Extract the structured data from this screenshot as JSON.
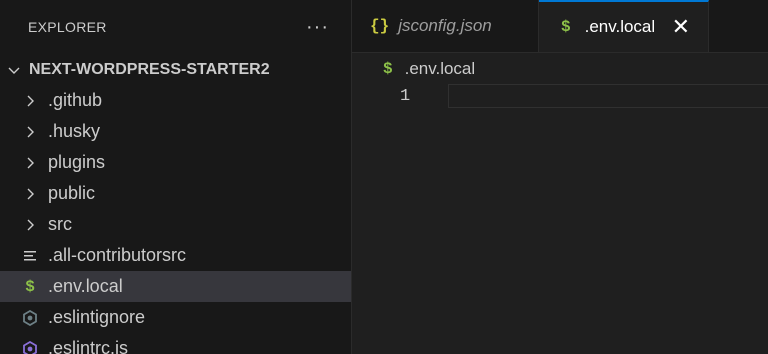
{
  "explorer": {
    "title": "EXPLORER",
    "more_glyph": "···",
    "root": {
      "label": "NEXT-WORDPRESS-STARTER2",
      "icon": "chevron-down-icon"
    },
    "items": [
      {
        "label": ".github",
        "icon": "chevron-right-icon",
        "type": "folder"
      },
      {
        "label": ".husky",
        "icon": "chevron-right-icon",
        "type": "folder"
      },
      {
        "label": "plugins",
        "icon": "chevron-right-icon",
        "type": "folder"
      },
      {
        "label": "public",
        "icon": "chevron-right-icon",
        "type": "folder"
      },
      {
        "label": "src",
        "icon": "chevron-right-icon",
        "type": "folder"
      },
      {
        "label": ".all-contributorsrc",
        "icon": "lines-file-icon",
        "type": "file"
      },
      {
        "label": ".env.local",
        "icon": "dollar-icon",
        "type": "file",
        "selected": true,
        "glyph": "$"
      },
      {
        "label": ".eslintignore",
        "icon": "eslint-ignore-icon",
        "type": "file"
      },
      {
        "label": ".eslintrc.js",
        "icon": "eslint-icon",
        "type": "file"
      }
    ]
  },
  "tabs": [
    {
      "label": "jsconfig.json",
      "icon": "json-braces-icon",
      "glyph": "{}",
      "active": false
    },
    {
      "label": ".env.local",
      "icon": "dollar-icon",
      "glyph": "$",
      "active": true,
      "close_glyph": "✕"
    }
  ],
  "breadcrumb": {
    "glyph": "$",
    "label": ".env.local"
  },
  "editor": {
    "lines": [
      {
        "number": "1",
        "text": ""
      }
    ]
  },
  "colors": {
    "accent": "#0078d4",
    "dollar": "#8dc149",
    "braces": "#cbcb41",
    "eslint": "#4b32c3",
    "selected_row": "#37373d"
  }
}
